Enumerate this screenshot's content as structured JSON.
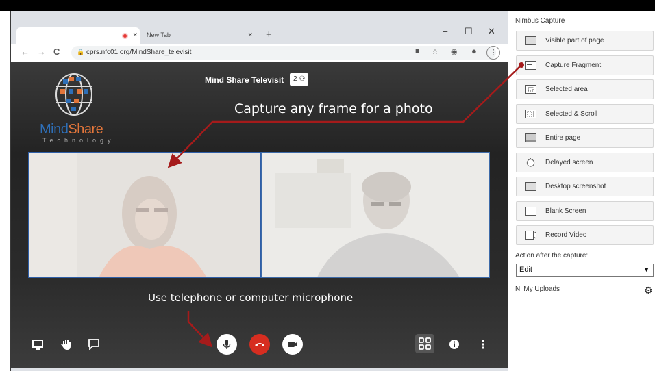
{
  "browser": {
    "tabs": [
      {
        "label": "",
        "recording": true,
        "close": "×"
      },
      {
        "label": "New Tab",
        "close": "×"
      }
    ],
    "new_tab": "+",
    "window_controls": {
      "minimize": "–",
      "maximize": "☐",
      "close": "✕"
    },
    "nav": {
      "back": "←",
      "forward": "→",
      "reload": "C"
    },
    "url": "cprs.nfc01.org/MindShare_televisit",
    "icons": [
      "camera-icon",
      "star-icon",
      "extension-icon",
      "profile-icon",
      "menu-icon"
    ]
  },
  "page": {
    "logo": {
      "brand_1": "Mind",
      "brand_2": "Share",
      "subtitle": "Technology"
    },
    "meeting_title": "Mind Share Televisit",
    "participant_count": "2",
    "annotations": {
      "capture": "Capture any frame for a photo",
      "mic": "Use telephone or computer microphone"
    },
    "toolbar_left": [
      "screen-share-icon",
      "raise-hand-icon",
      "chat-icon"
    ],
    "toolbar_center": [
      "microphone-icon",
      "hangup-icon",
      "camera-icon"
    ],
    "toolbar_right": [
      "grid-view-icon",
      "info-icon",
      "more-icon"
    ],
    "colors": {
      "hangup": "#d62d20",
      "video_border": "#2f5fa8",
      "annotation_arrow": "#a51b1b"
    }
  },
  "nimbus": {
    "title": "Nimbus Capture",
    "buttons": [
      {
        "label": "Visible part of page",
        "icon": "visible-page-icon"
      },
      {
        "label": "Capture Fragment",
        "icon": "fragment-icon"
      },
      {
        "label": "Selected area",
        "icon": "selected-area-icon"
      },
      {
        "label": "Selected & Scroll",
        "icon": "scroll-icon"
      },
      {
        "label": "Entire page",
        "icon": "entire-page-icon"
      },
      {
        "label": "Delayed screen",
        "icon": "timer-icon"
      },
      {
        "label": "Desktop screenshot",
        "icon": "desktop-icon"
      },
      {
        "label": "Blank Screen",
        "icon": "blank-icon"
      },
      {
        "label": "Record Video",
        "icon": "video-icon"
      }
    ],
    "action_label": "Action after the capture:",
    "action_value": "Edit",
    "uploads_prefix": "N",
    "uploads_label": "My Uploads"
  }
}
